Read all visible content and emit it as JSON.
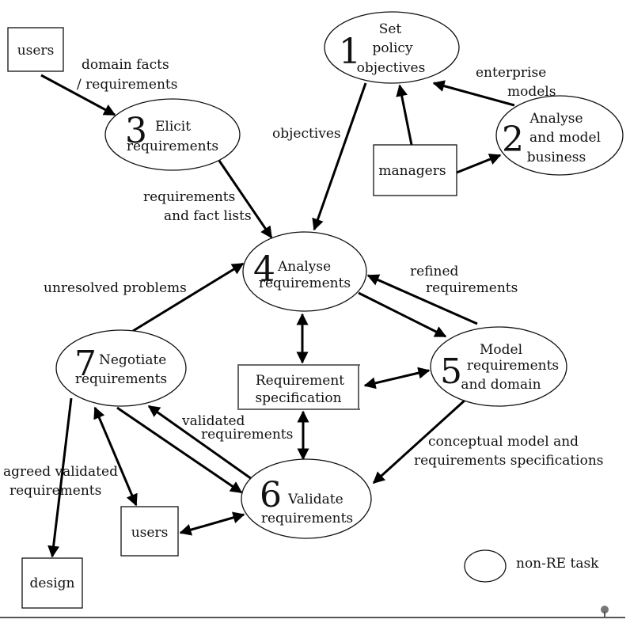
{
  "tasks": [
    {
      "number": "1",
      "lines": [
        "Set",
        "policy",
        "objectives"
      ]
    },
    {
      "number": "2",
      "lines": [
        "Analyse",
        "and model",
        "business"
      ]
    },
    {
      "number": "3",
      "lines": [
        "Elicit",
        "requirements"
      ]
    },
    {
      "number": "4",
      "lines": [
        "Analyse",
        "requirements"
      ]
    },
    {
      "number": "5",
      "lines": [
        "Model",
        "requirements",
        "and domain"
      ]
    },
    {
      "number": "6",
      "lines": [
        "Validate",
        "requirements"
      ]
    },
    {
      "number": "7",
      "lines": [
        "Negotiate",
        "requirements"
      ]
    }
  ],
  "boxes": {
    "users_top": "users",
    "managers": "managers",
    "spec": [
      "Requirement",
      "specification"
    ],
    "users_bottom": "users",
    "design": "design"
  },
  "flows": {
    "domain_facts": [
      "domain facts",
      "/ requirements"
    ],
    "objectives": "objectives",
    "enterprise_models": [
      "enterprise",
      "models"
    ],
    "req_fact_lists": [
      "requirements",
      "and fact lists"
    ],
    "unresolved": "unresolved problems",
    "refined": [
      "refined",
      "requirements"
    ],
    "validated": [
      "validated",
      "requirements"
    ],
    "conceptual": [
      "conceptual model and",
      "requirements specifications"
    ],
    "agreed": [
      "agreed validated",
      "requirements"
    ]
  },
  "legend": {
    "label": "non-RE task"
  }
}
